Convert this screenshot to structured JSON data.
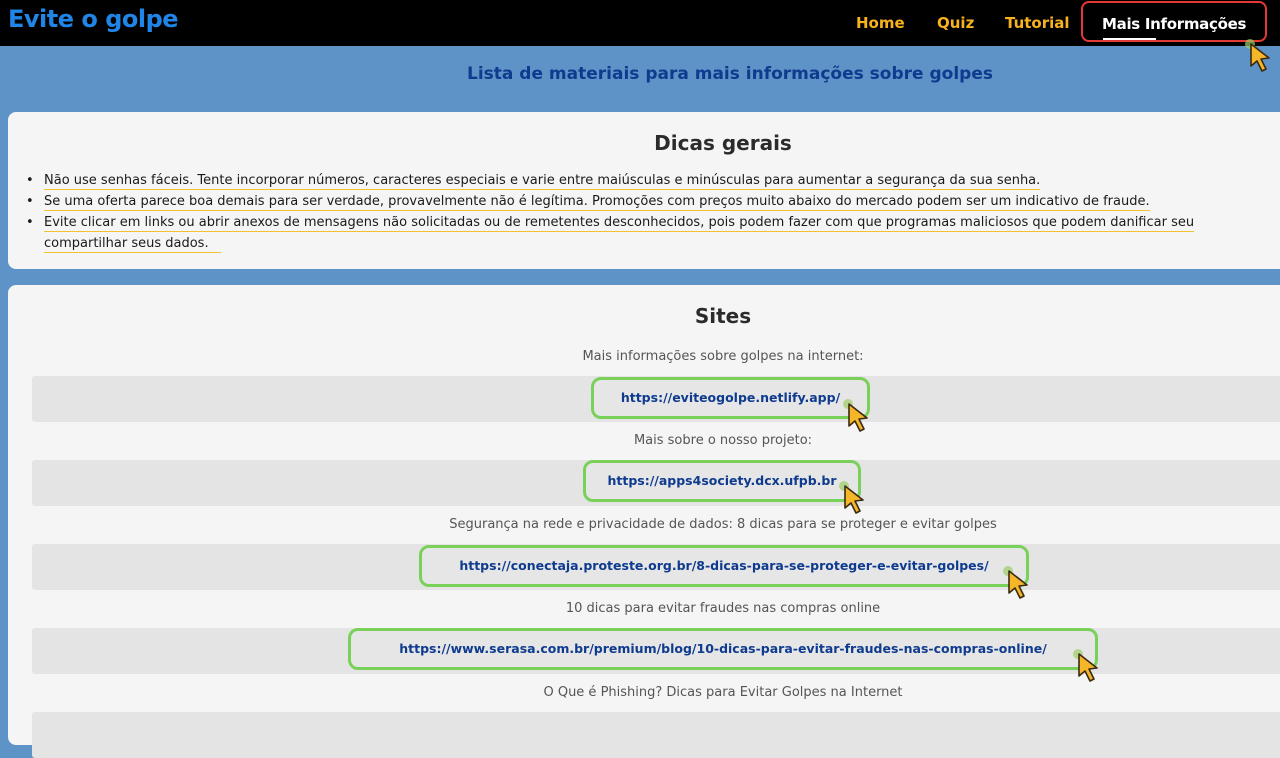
{
  "nav": {
    "brand": "Evite o golpe",
    "home": "Home",
    "quiz": "Quiz",
    "tutorial": "Tutorial",
    "more_info": "Mais Informações"
  },
  "page_heading": "Lista de materiais para mais informações sobre golpes",
  "tips": {
    "title": "Dicas gerais",
    "items": [
      "Não use senhas fáceis. Tente incorporar números, caracteres especiais e varie entre maiúsculas e minúsculas para aumentar a segurança da sua senha.",
      "Se uma oferta parece boa demais para ser verdade, provavelmente não é legítima. Promoções com preços muito abaixo do mercado podem ser um indicativo de fraude.",
      "Evite clicar em links ou abrir anexos de mensagens não solicitadas ou de remetentes desconhecidos, pois podem fazer com que programas maliciosos que podem danificar seu",
      "compartilhar seus dados."
    ]
  },
  "sites": {
    "title": "Sites",
    "entries": [
      {
        "label": "Mais informações sobre golpes na internet:",
        "url": "https://eviteogolpe.netlify.app/"
      },
      {
        "label": "Mais sobre o nosso projeto:",
        "url": "https://apps4society.dcx.ufpb.br"
      },
      {
        "label": "Segurança na rede e privacidade de dados: 8 dicas para se proteger e evitar golpes",
        "url": "https://conectaja.proteste.org.br/8-dicas-para-se-proteger-e-evitar-golpes/"
      },
      {
        "label": "10 dicas para evitar fraudes nas compras online",
        "url": "https://www.serasa.com.br/premium/blog/10-dicas-para-evitar-fraudes-nas-compras-online/"
      },
      {
        "label": "O Que é Phishing? Dicas para Evitar Golpes na Internet",
        "url": ""
      }
    ]
  },
  "colors": {
    "accent_nav": "#f7b21d",
    "brand": "#1f86e8",
    "active_outline": "#e53935",
    "link_frame": "#7ad15a",
    "link_text": "#0f3b8f",
    "background": "#5e93c7"
  },
  "icons": {
    "cursor": "hand-pointer-cursor-icon"
  }
}
